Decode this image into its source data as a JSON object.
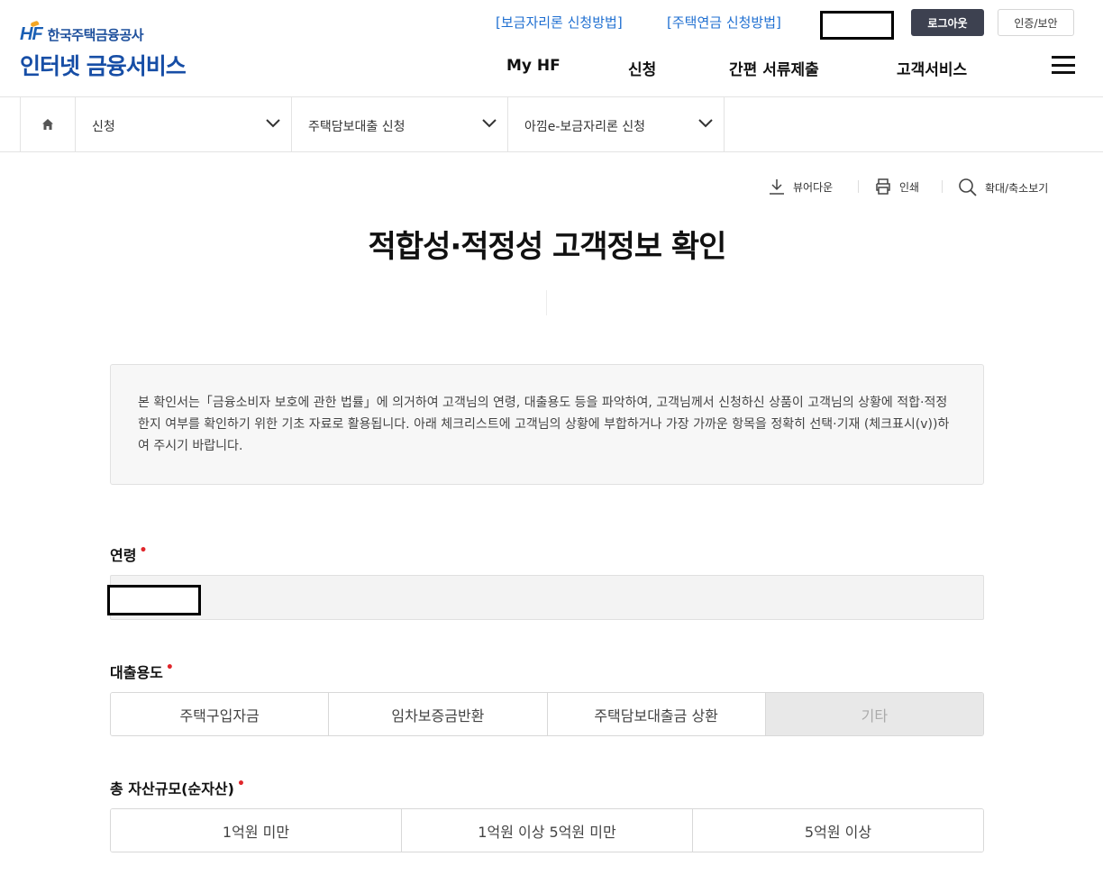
{
  "header": {
    "logo_mark": "HF",
    "logo_org": "한국주택금융공사",
    "logo_title": "인터넷 금융서비스",
    "top_links": [
      "[보금자리론 신청방법]",
      "[주택연금 신청방법]"
    ],
    "logout_label": "로그아웃",
    "cert_label": "인증/보안",
    "gnb": [
      "My HF",
      "신청",
      "간편 서류제출",
      "고객서비스"
    ]
  },
  "breadcrumb": {
    "items": [
      "신청",
      "주택담보대출 신청",
      "아낌e-보금자리론 신청"
    ]
  },
  "utilities": {
    "viewer_download": "뷰어다운",
    "print": "인쇄",
    "zoom": "확대/축소보기"
  },
  "page": {
    "title": "적합성·적정성 고객정보 확인",
    "notice": "본 확인서는「금융소비자 보호에 관한 법률」에 의거하여 고객님의 연령, 대출용도 등을 파악하여, 고객님께서 신청하신 상품이 고객님의 상황에 적합·적정한지 여부를 확인하기 위한 기초 자료로 활용됩니다. 아래 체크리스트에 고객님의 상황에 부합하거나 가장 가까운 항목을 정확히 선택·기재 (체크표시(v))하여 주시기 바랍니다."
  },
  "form": {
    "age_label": "연령",
    "purpose_label": "대출용도",
    "purpose_options": [
      "주택구입자금",
      "임차보증금반환",
      "주택담보대출금 상환",
      "기타"
    ],
    "assets_label": "총 자산규모(순자산)",
    "assets_options": [
      "1억원 미만",
      "1억원 이상 5억원 미만",
      "5억원 이상"
    ],
    "required_mark": "•"
  },
  "colors": {
    "brand_blue": "#174ea6",
    "link_blue": "#1f6fd1",
    "logout_bg": "#3d4150",
    "required_red": "#e0262b"
  }
}
